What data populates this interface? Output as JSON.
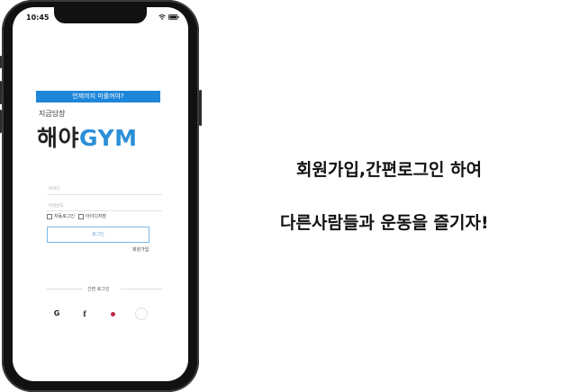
{
  "status_bar": {
    "time": "10:45"
  },
  "login": {
    "banner": "언제까지 미룰꺼야?",
    "subtitle": "지금당장",
    "logo_korean": "해야",
    "logo_latin": "GYM",
    "id_placeholder": "아이디",
    "password_placeholder": "비밀번호",
    "auto_login": "자동로그인",
    "save_id": "아이디저장",
    "login_button": "로그인",
    "signup_link": "회원가입",
    "easy_login_label": "간편 로그인",
    "social_buttons": [
      {
        "icon": "google-icon",
        "glyph": "G"
      },
      {
        "icon": "facebook-icon",
        "glyph": "f"
      },
      {
        "icon": "youtube-icon",
        "glyph": "●"
      },
      {
        "icon": "apple-icon",
        "glyph": ""
      }
    ]
  },
  "promo": {
    "line1": "회원가입,간편로그인 하여",
    "line2": "다른사람들과 운동을 즐기자!"
  },
  "colors": {
    "accent": "#1e86d9",
    "logo_accent": "#2b8fd8",
    "phone_frame": "#111111"
  }
}
